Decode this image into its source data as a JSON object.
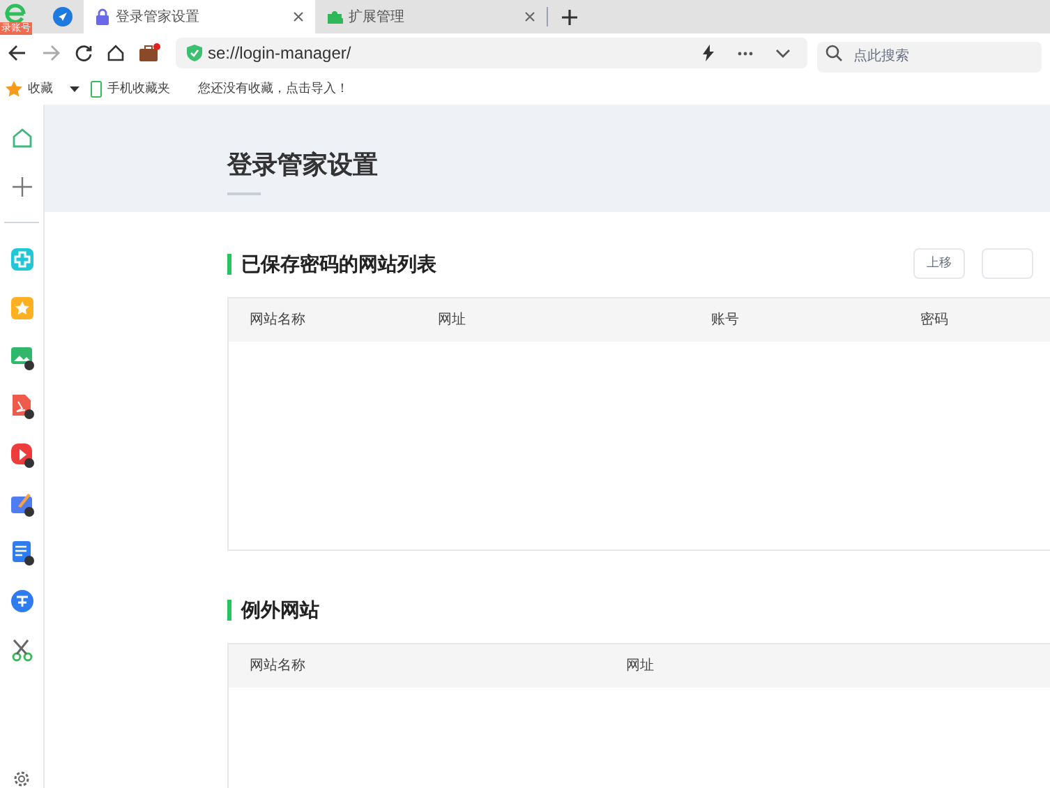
{
  "browser": {
    "logo_badge": "录账号",
    "tabs": [
      {
        "title": "登录管家设置",
        "selected": true
      },
      {
        "title": "扩展管理",
        "selected": false
      }
    ],
    "address": "se://login-manager/",
    "search": {
      "placeholder": "点此搜索"
    },
    "bookmarks": {
      "favorites": "收藏",
      "mobile": "手机收藏夹",
      "empty_hint": "您还没有收藏，点击导入！"
    }
  },
  "sidebar": {
    "items": [
      {
        "kind": "home"
      },
      {
        "kind": "plus"
      },
      {
        "kind": "divider"
      },
      {
        "kind": "cross",
        "color": "#22c7d6"
      },
      {
        "kind": "star",
        "color": "#ffb020"
      },
      {
        "kind": "image",
        "color": "#2fb86a"
      },
      {
        "kind": "pdf",
        "color": "#ef5b4b"
      },
      {
        "kind": "play",
        "color": "#ee3b3b"
      },
      {
        "kind": "note",
        "color": "#4f7cf0"
      },
      {
        "kind": "doc",
        "color": "#2f7cf0"
      },
      {
        "kind": "translate",
        "color": "#2f7cf0"
      },
      {
        "kind": "scissors",
        "color": "#3bb85a"
      }
    ]
  },
  "page": {
    "title": "登录管家设置",
    "sections": [
      {
        "title": "已保存密码的网站列表",
        "buttons": [
          {
            "label": "上移",
            "disabled": true
          },
          {
            "disabled": true
          }
        ],
        "columns": [
          "网站名称",
          "网址",
          "账号",
          "密码"
        ]
      },
      {
        "title": "例外网站",
        "columns": [
          "网站名称",
          "网址"
        ]
      }
    ]
  }
}
